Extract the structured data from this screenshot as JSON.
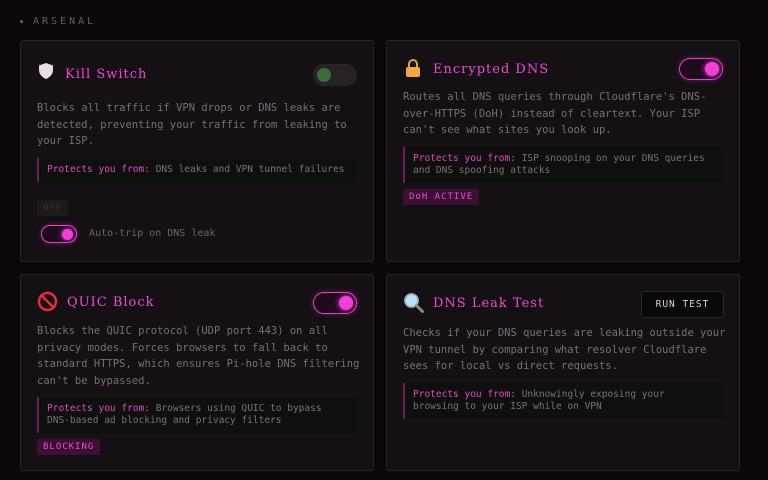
{
  "section": {
    "label": "ARSENAL"
  },
  "cards": {
    "kill_switch": {
      "icon": "shield-icon",
      "title": "Kill Switch",
      "toggle_state": "off",
      "description": "Blocks all traffic if VPN drops or DNS leaks are detected, preventing your traffic from leaking to your ISP.",
      "protects_label": "Protects you from:",
      "protects_text": "DNS leaks and VPN tunnel failures",
      "badge": "OFF",
      "auto_trip": {
        "state": "on",
        "label": "Auto-trip on DNS leak"
      }
    },
    "encrypted_dns": {
      "icon": "lock-icon",
      "title": "Encrypted DNS",
      "toggle_state": "on",
      "description": "Routes all DNS queries through Cloudflare's DNS-over-HTTPS (DoH) instead of cleartext. Your ISP can't see what sites you look up.",
      "protects_label": "Protects you from:",
      "protects_text": "ISP snooping on your DNS queries and DNS spoofing attacks",
      "badge": "DoH ACTIVE"
    },
    "quic_block": {
      "icon": "prohibited-icon",
      "title": "QUIC Block",
      "toggle_state": "on",
      "description": "Blocks the QUIC protocol (UDP port 443) on all privacy modes. Forces browsers to fall back to standard HTTPS, which ensures Pi-hole DNS filtering can't be bypassed.",
      "protects_label": "Protects you from:",
      "protects_text": "Browsers using QUIC to bypass DNS-based ad blocking and privacy filters",
      "badge": "BLOCKING"
    },
    "dns_leak_test": {
      "icon": "magnifier-icon",
      "title": "DNS Leak Test",
      "button": "RUN TEST",
      "description": "Checks if your DNS queries are leaking outside your VPN tunnel by comparing what resolver Cloudflare sees for local vs direct requests.",
      "protects_label": "Protects you from:",
      "protects_text": "Unknowingly exposing your browsing to your ISP while on VPN"
    }
  },
  "colors": {
    "accent": "#f14ad8",
    "background": "#0b070b",
    "card": "#141014"
  }
}
